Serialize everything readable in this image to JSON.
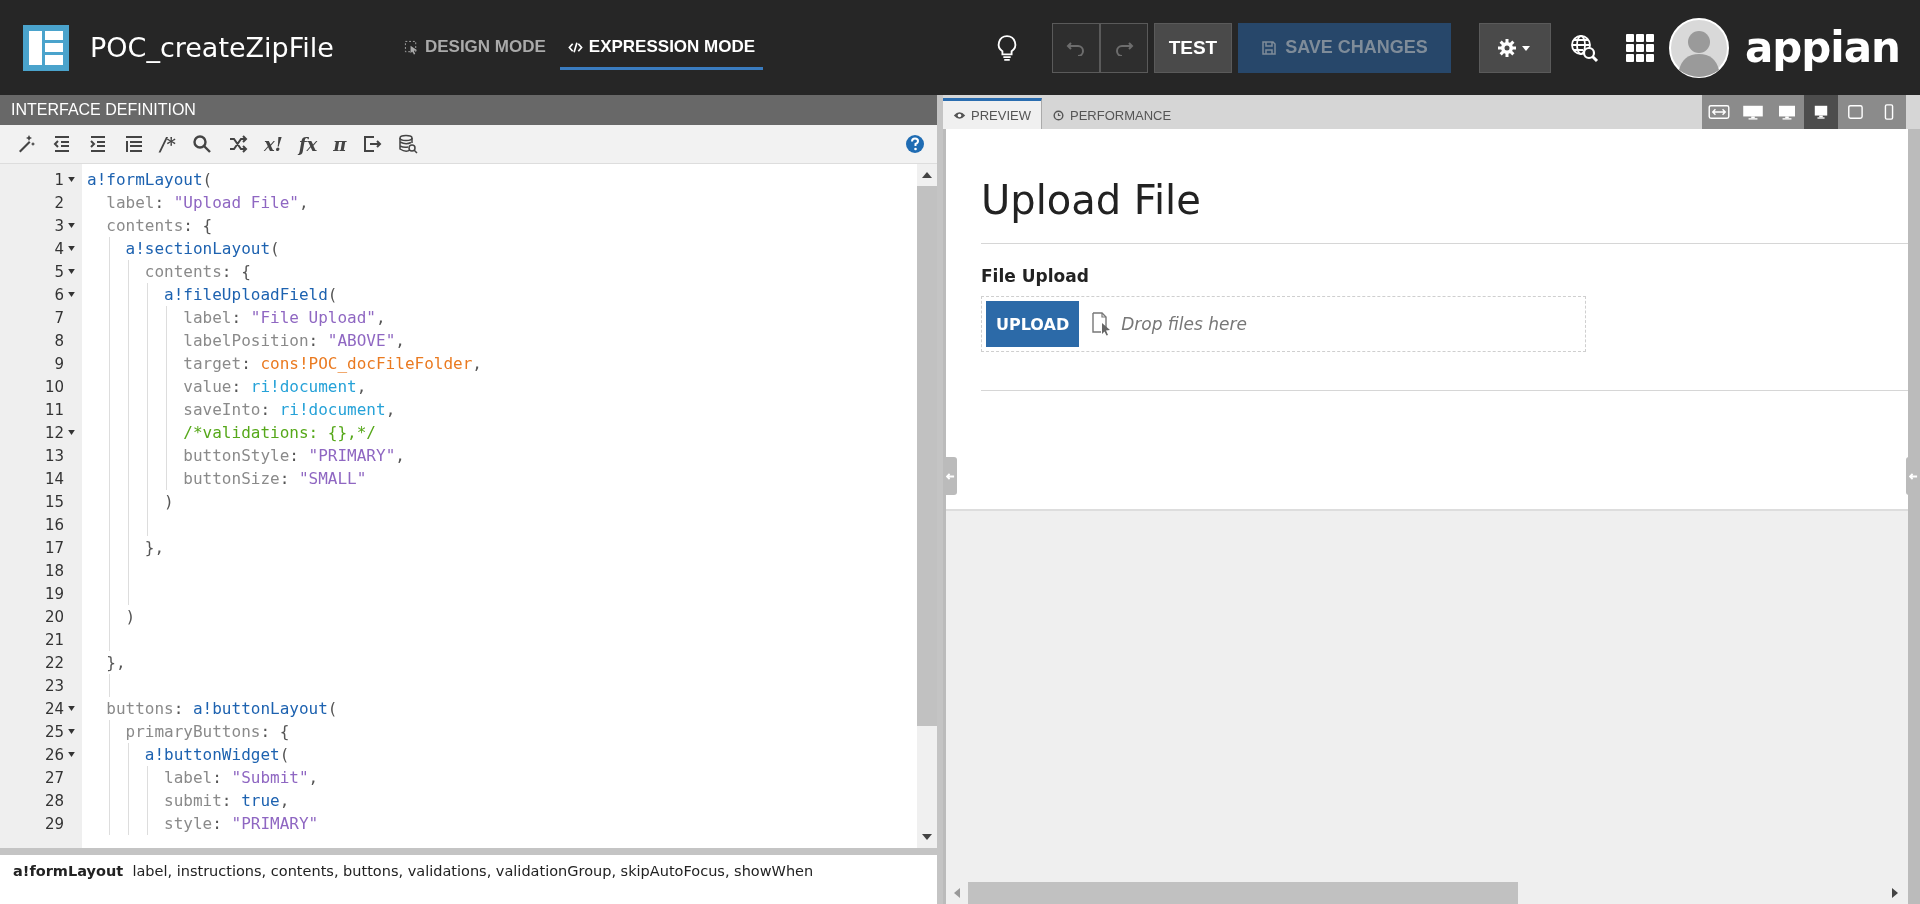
{
  "header": {
    "title": "POC_createZipFile",
    "modes": [
      {
        "label": "DESIGN MODE",
        "kind": "design",
        "selected": false
      },
      {
        "label": "EXPRESSION MODE",
        "kind": "expression",
        "selected": true
      }
    ],
    "undo": {
      "disabled": true
    },
    "redo": {
      "disabled": true
    },
    "test_button": "TEST",
    "save_button": {
      "label": "SAVE CHANGES",
      "disabled": true
    },
    "brand": "appian"
  },
  "editor": {
    "title": "INTERFACE DEFINITION",
    "toolbar": [
      {
        "kind": "wand"
      },
      {
        "kind": "outdent"
      },
      {
        "kind": "indent"
      },
      {
        "kind": "list"
      },
      {
        "kind": "text",
        "label": "/*"
      },
      {
        "kind": "search"
      },
      {
        "kind": "shuffle"
      },
      {
        "kind": "text",
        "label": "x!"
      },
      {
        "kind": "text",
        "label": "fx"
      },
      {
        "kind": "text",
        "label": "π"
      },
      {
        "kind": "export"
      },
      {
        "kind": "database"
      }
    ],
    "lines": [
      {
        "number": "1",
        "fold": true,
        "tokens": [
          {
            "kind": "fn",
            "text": "a!formLayout"
          },
          {
            "kind": "punct",
            "text": "("
          }
        ]
      },
      {
        "number": "2",
        "fold": false,
        "tokens": [
          {
            "kind": "key",
            "text": "  label"
          },
          {
            "kind": "punct",
            "text": ": "
          },
          {
            "kind": "str",
            "text": "\"Upload File\""
          },
          {
            "kind": "punct",
            "text": ","
          }
        ]
      },
      {
        "number": "3",
        "fold": true,
        "tokens": [
          {
            "kind": "key",
            "text": "  contents"
          },
          {
            "kind": "punct",
            "text": ": {"
          }
        ]
      },
      {
        "number": "4",
        "fold": true,
        "tokens": [
          {
            "kind": "fn",
            "text": "    a!sectionLayout"
          },
          {
            "kind": "punct",
            "text": "("
          }
        ]
      },
      {
        "number": "5",
        "fold": true,
        "tokens": [
          {
            "kind": "key",
            "text": "      contents"
          },
          {
            "kind": "punct",
            "text": ": {"
          }
        ]
      },
      {
        "number": "6",
        "fold": true,
        "tokens": [
          {
            "kind": "fn",
            "text": "        a!fileUploadField"
          },
          {
            "kind": "punct",
            "text": "("
          }
        ]
      },
      {
        "number": "7",
        "fold": false,
        "tokens": [
          {
            "kind": "key",
            "text": "          label"
          },
          {
            "kind": "punct",
            "text": ": "
          },
          {
            "kind": "str",
            "text": "\"File Upload\""
          },
          {
            "kind": "punct",
            "text": ","
          }
        ]
      },
      {
        "number": "8",
        "fold": false,
        "tokens": [
          {
            "kind": "key",
            "text": "          labelPosition"
          },
          {
            "kind": "punct",
            "text": ": "
          },
          {
            "kind": "str",
            "text": "\"ABOVE\""
          },
          {
            "kind": "punct",
            "text": ","
          }
        ]
      },
      {
        "number": "9",
        "fold": false,
        "tokens": [
          {
            "kind": "key",
            "text": "          target"
          },
          {
            "kind": "punct",
            "text": ": "
          },
          {
            "kind": "const",
            "text": "cons!POC_docFileFolder"
          },
          {
            "kind": "punct",
            "text": ","
          }
        ]
      },
      {
        "number": "10",
        "fold": false,
        "tokens": [
          {
            "kind": "key",
            "text": "          value"
          },
          {
            "kind": "punct",
            "text": ": "
          },
          {
            "kind": "var",
            "text": "ri!document"
          },
          {
            "kind": "punct",
            "text": ","
          }
        ]
      },
      {
        "number": "11",
        "fold": false,
        "tokens": [
          {
            "kind": "key",
            "text": "          saveInto"
          },
          {
            "kind": "punct",
            "text": ": "
          },
          {
            "kind": "var",
            "text": "ri!document"
          },
          {
            "kind": "punct",
            "text": ","
          }
        ]
      },
      {
        "number": "12",
        "fold": true,
        "tokens": [
          {
            "kind": "comment",
            "text": "          /*validations: {},*/"
          }
        ]
      },
      {
        "number": "13",
        "fold": false,
        "tokens": [
          {
            "kind": "key",
            "text": "          buttonStyle"
          },
          {
            "kind": "punct",
            "text": ": "
          },
          {
            "kind": "str",
            "text": "\"PRIMARY\""
          },
          {
            "kind": "punct",
            "text": ","
          }
        ]
      },
      {
        "number": "14",
        "fold": false,
        "tokens": [
          {
            "kind": "key",
            "text": "          buttonSize"
          },
          {
            "kind": "punct",
            "text": ": "
          },
          {
            "kind": "str",
            "text": "\"SMALL\""
          }
        ]
      },
      {
        "number": "15",
        "fold": false,
        "tokens": [
          {
            "kind": "punct",
            "text": "        )"
          }
        ]
      },
      {
        "number": "16",
        "fold": false
      },
      {
        "number": "17",
        "fold": false,
        "tokens": [
          {
            "kind": "punct",
            "text": "      },"
          }
        ]
      },
      {
        "number": "18",
        "fold": false
      },
      {
        "number": "19",
        "fold": false
      },
      {
        "number": "20",
        "fold": false,
        "tokens": [
          {
            "kind": "punct",
            "text": "    )"
          }
        ]
      },
      {
        "number": "21",
        "fold": false
      },
      {
        "number": "22",
        "fold": false,
        "tokens": [
          {
            "kind": "punct",
            "text": "  },"
          }
        ]
      },
      {
        "number": "23",
        "fold": false
      },
      {
        "number": "24",
        "fold": true,
        "tokens": [
          {
            "kind": "key",
            "text": "  buttons"
          },
          {
            "kind": "punct",
            "text": ": "
          },
          {
            "kind": "fn",
            "text": "a!buttonLayout"
          },
          {
            "kind": "punct",
            "text": "("
          }
        ]
      },
      {
        "number": "25",
        "fold": true,
        "tokens": [
          {
            "kind": "key",
            "text": "    primaryButtons"
          },
          {
            "kind": "punct",
            "text": ": {"
          }
        ]
      },
      {
        "number": "26",
        "fold": true,
        "tokens": [
          {
            "kind": "fn",
            "text": "      a!buttonWidget"
          },
          {
            "kind": "punct",
            "text": "("
          }
        ]
      },
      {
        "number": "27",
        "fold": false,
        "tokens": [
          {
            "kind": "key",
            "text": "        label"
          },
          {
            "kind": "punct",
            "text": ": "
          },
          {
            "kind": "str",
            "text": "\"Submit\""
          },
          {
            "kind": "punct",
            "text": ","
          }
        ]
      },
      {
        "number": "28",
        "fold": false,
        "tokens": [
          {
            "kind": "key",
            "text": "        submit"
          },
          {
            "kind": "punct",
            "text": ": "
          },
          {
            "kind": "bool",
            "text": "true"
          },
          {
            "kind": "punct",
            "text": ","
          }
        ]
      },
      {
        "number": "29",
        "fold": false,
        "tokens": [
          {
            "kind": "key",
            "text": "        style"
          },
          {
            "kind": "punct",
            "text": ": "
          },
          {
            "kind": "str",
            "text": "\"PRIMARY\""
          }
        ]
      }
    ],
    "doc": {
      "name": "a!formLayout",
      "params": "label, instructions, contents, buttons, validations, validationGroup, skipAutoFocus, showWhen"
    }
  },
  "preview": {
    "tabs": [
      {
        "label": "PREVIEW",
        "kind": "eye",
        "selected": true
      },
      {
        "label": "PERFORMANCE",
        "kind": "clock",
        "selected": false
      }
    ],
    "devices": [
      {
        "kind": "fit",
        "selected": false
      },
      {
        "kind": "wide",
        "selected": false
      },
      {
        "kind": "desktop",
        "selected": false
      },
      {
        "kind": "laptop",
        "selected": true
      },
      {
        "kind": "tablet",
        "selected": false
      },
      {
        "kind": "phone",
        "selected": false
      }
    ],
    "form_title": "Upload File",
    "field_label": "File Upload",
    "upload_button": "UPLOAD",
    "drop_placeholder": "Drop files here"
  }
}
